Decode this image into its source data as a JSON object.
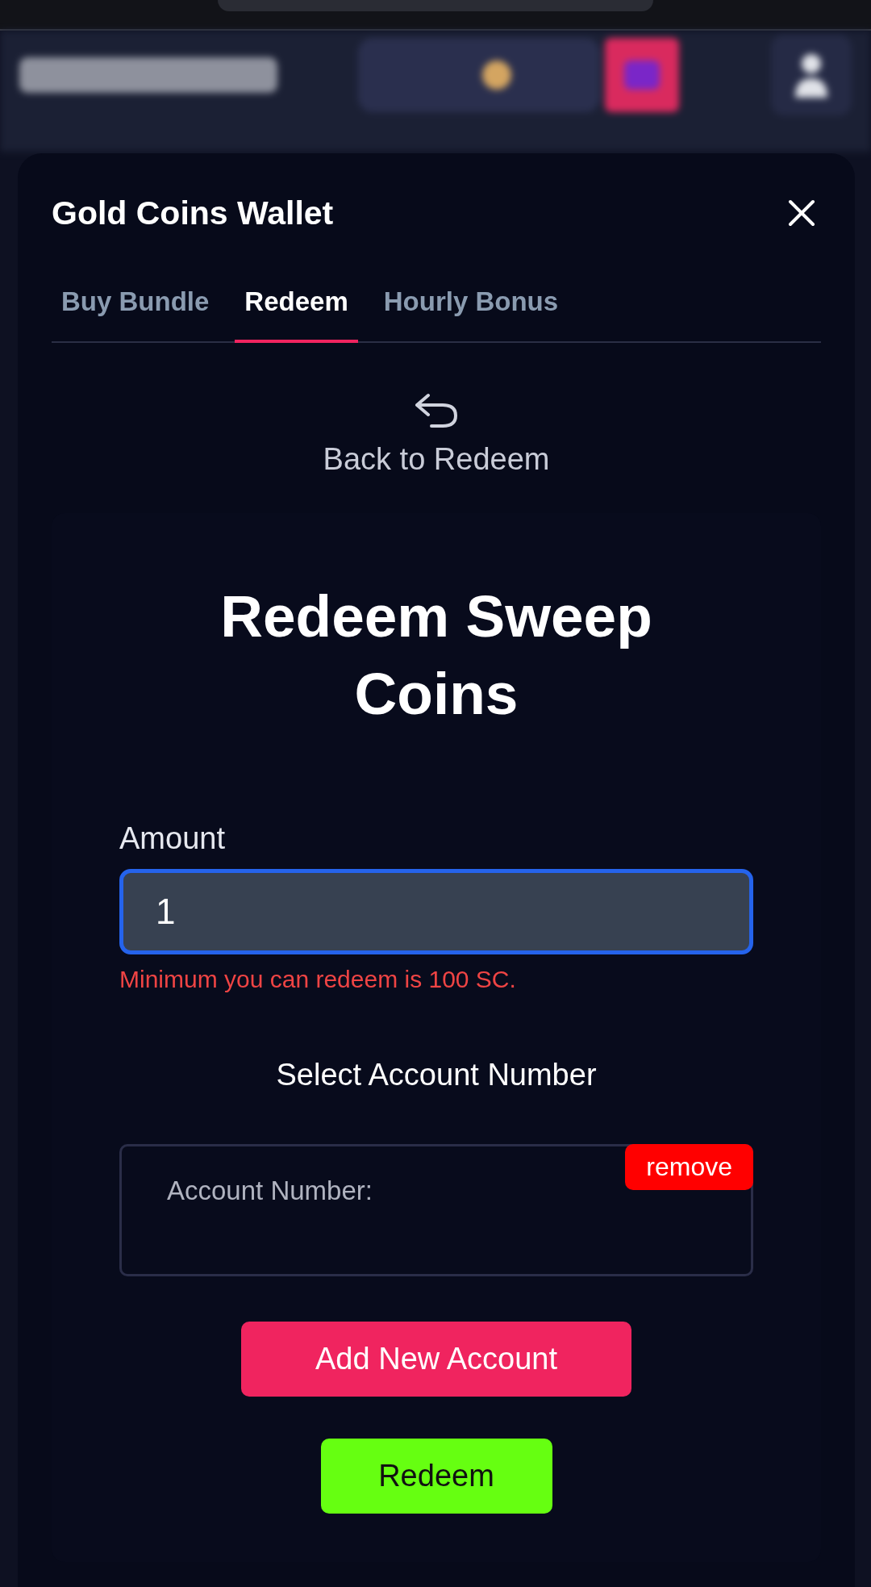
{
  "modal": {
    "title": "Gold Coins Wallet",
    "tabs": [
      {
        "label": "Buy Bundle",
        "selected": false
      },
      {
        "label": "Redeem",
        "selected": true
      },
      {
        "label": "Hourly Bonus",
        "selected": false
      }
    ],
    "back_link": "Back to Redeem",
    "form": {
      "heading": "Redeem Sweep Coins",
      "amount_label": "Amount",
      "amount_value": "1",
      "error": "Minimum you can redeem is 100 SC.",
      "account_section_label": "Select Account Number",
      "accounts": [
        {
          "label": "Account Number:",
          "remove": "remove"
        }
      ],
      "add_account_button": "Add New Account",
      "redeem_button": "Redeem"
    }
  }
}
